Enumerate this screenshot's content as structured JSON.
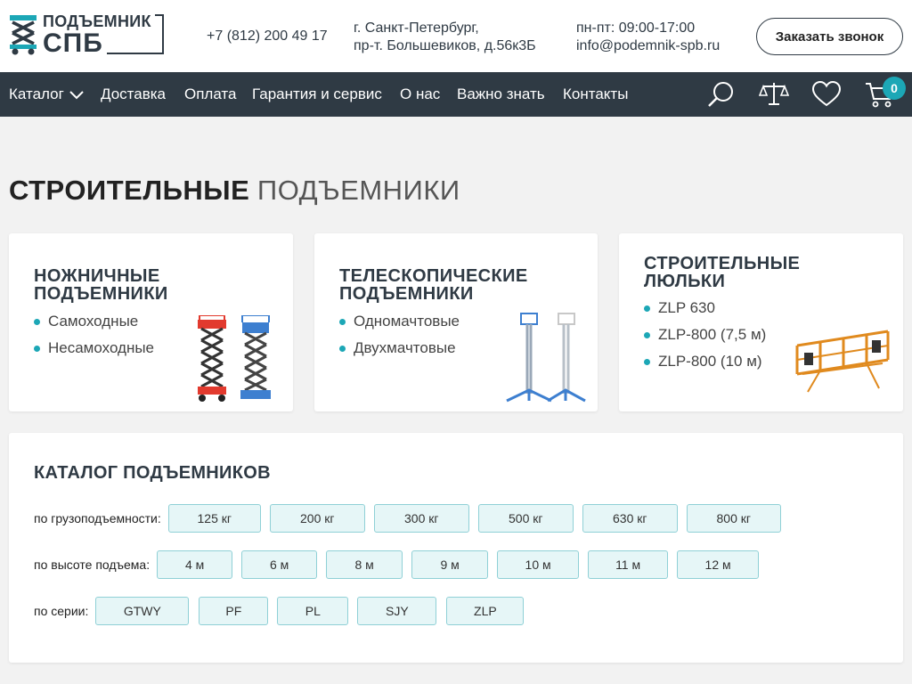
{
  "header": {
    "logo_line1": "ПОДЪЕМНИК",
    "logo_line2": "СПБ",
    "phone": "+7 (812) 200 49 17",
    "address_line1": "г. Санкт-Петербург,",
    "address_line2": "пр-т. Большевиков, д.56к3Б",
    "hours": "пн-пт: 09:00-17:00",
    "email": "info@podemnik-spb.ru",
    "callback_button": "Заказать звонок"
  },
  "nav": {
    "items": [
      "Каталог",
      "Доставка",
      "Оплата",
      "Гарантия и сервис",
      "О нас",
      "Важно знать",
      "Контакты"
    ],
    "icons": [
      "search-icon",
      "compare-scales-icon",
      "heart-icon",
      "cart-icon"
    ],
    "cart_count": "0"
  },
  "page": {
    "title_bold": "СТРОИТЕЛЬНЫЕ",
    "title_light": "ПОДЪЕМНИКИ"
  },
  "cards": [
    {
      "title_line1": "НОЖНИЧНЫЕ",
      "title_line2": "ПОДЪЕМНИКИ",
      "items": [
        "Самоходные",
        "Несамоходные"
      ]
    },
    {
      "title_line1": "ТЕЛЕСКОПИЧЕСКИЕ",
      "title_line2": "ПОДЪЕМНИКИ",
      "items": [
        "Одномачтовые",
        "Двухмачтовые"
      ]
    },
    {
      "title_line1": "СТРОИТЕЛЬНЫЕ",
      "title_line2": "ЛЮЛЬКИ",
      "items": [
        "ZLP 630",
        "ZLP-800 (7,5 м)",
        "ZLP-800 (10 м)"
      ]
    }
  ],
  "catalog": {
    "title": "КАТАЛОГ ПОДЪЕМНИКОВ",
    "filters": [
      {
        "label": "по грузоподъемности:",
        "options": [
          "125 кг",
          "200 кг",
          "300 кг",
          "500 кг",
          "630 кг",
          "800 кг"
        ]
      },
      {
        "label": "по высоте подъема:",
        "options": [
          "4 м",
          "6 м",
          "8 м",
          "9 м",
          "10 м",
          "11 м",
          "12 м"
        ]
      },
      {
        "label": "по серии:",
        "options": [
          "GTWY",
          "PF",
          "PL",
          "SJY",
          "ZLP"
        ]
      }
    ]
  },
  "colors": {
    "dark": "#2f3a44",
    "accent": "#1ca7b6",
    "chip_bg": "#e6f6f7",
    "chip_border": "#8fd0d6"
  }
}
